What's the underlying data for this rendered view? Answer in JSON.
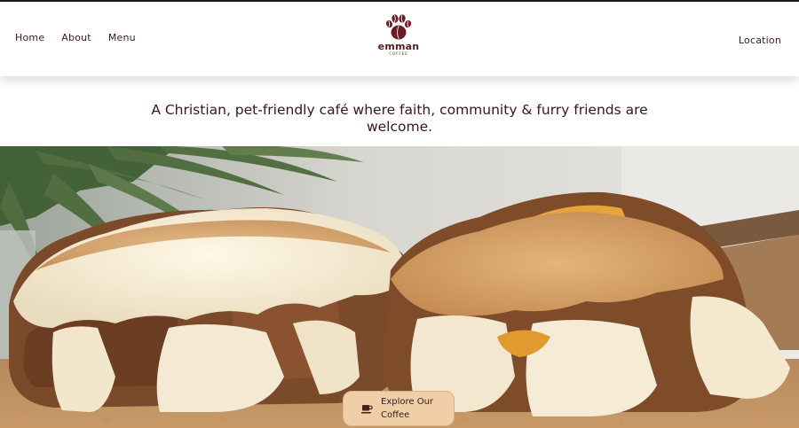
{
  "header": {
    "nav_left": [
      "Home",
      "About",
      "Menu"
    ],
    "nav_right": "Location",
    "logo": {
      "word": "emman",
      "sub": "COFFEE",
      "icon": "paw-coffee-bean-icon"
    }
  },
  "tagline": "A Christian, pet-friendly café where faith, community & furry friends are welcome.",
  "hero": {
    "image": "waffle-sandwiches-photo",
    "cta": {
      "label": "Explore Our Coffee",
      "icon": "coffee-cup-icon"
    }
  },
  "colors": {
    "brand": "#5a1c1c",
    "cta_bg": "#f0cfa8",
    "text": "#3c1616"
  }
}
